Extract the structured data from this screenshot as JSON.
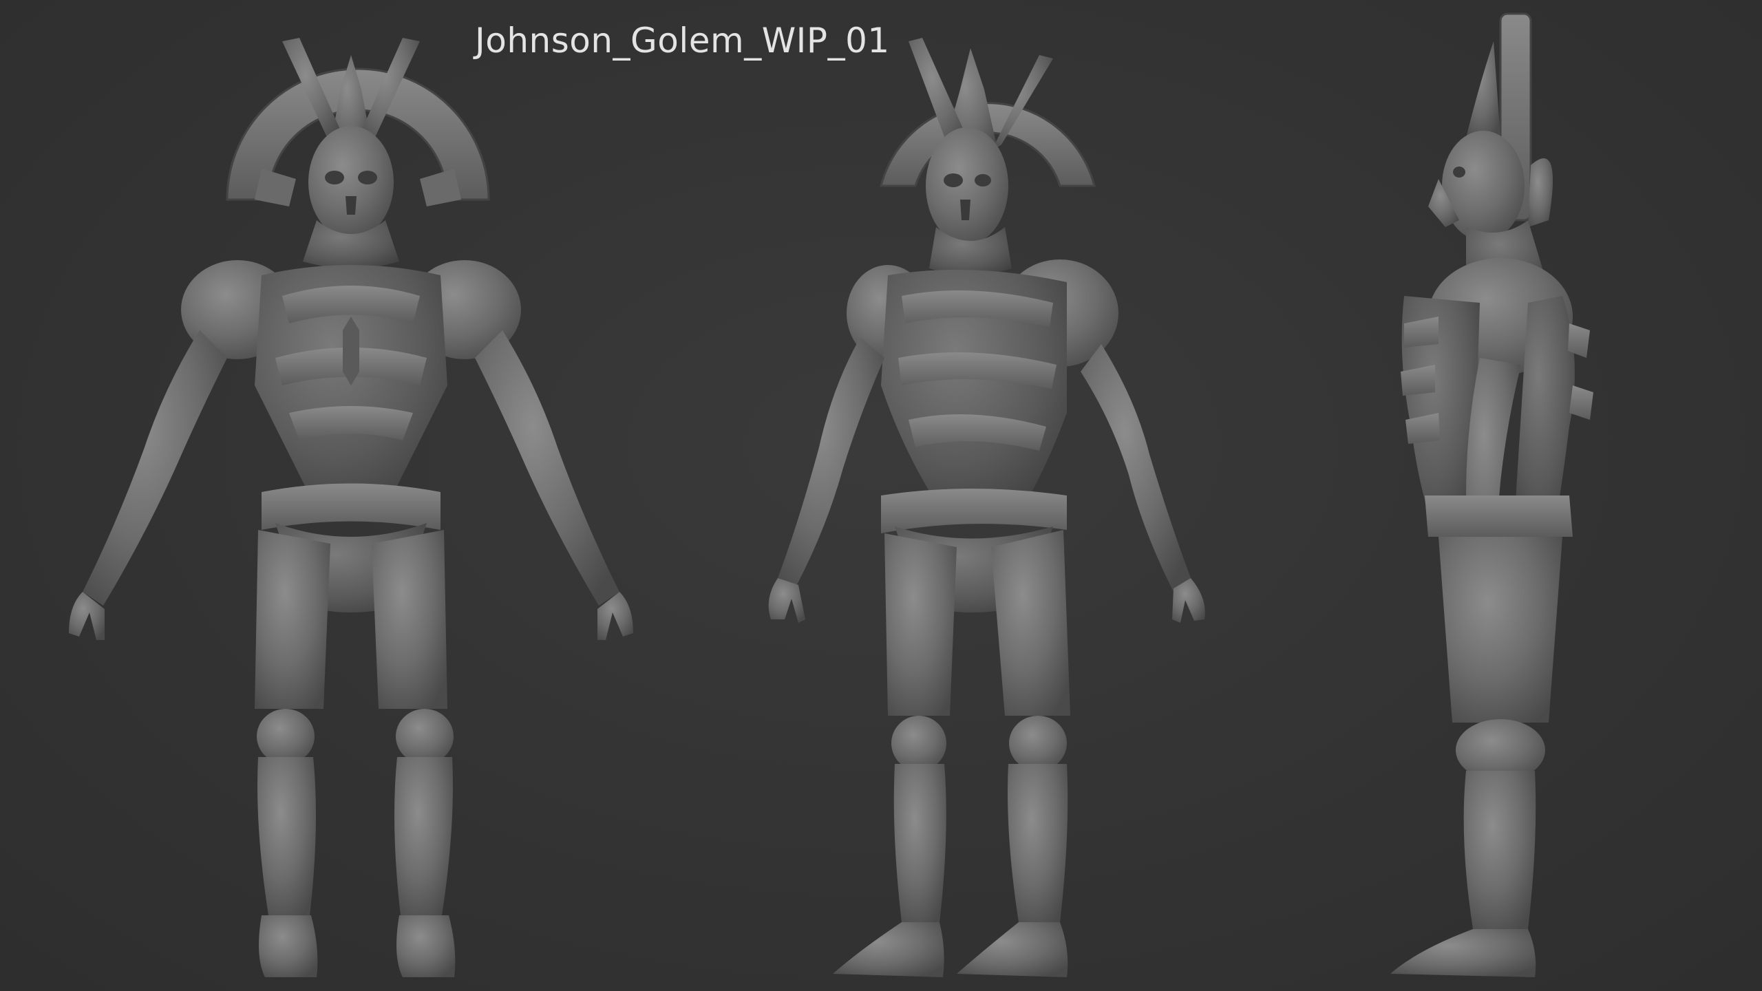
{
  "title": "Johnson_Golem_WIP_01",
  "views": [
    {
      "id": "front",
      "name": "front-view"
    },
    {
      "id": "three-quarter",
      "name": "three-quarter-view"
    },
    {
      "id": "side",
      "name": "side-view"
    }
  ],
  "colors": {
    "background": "#343434",
    "clay": "#6e6e6e",
    "clay_light": "#8a8a8a",
    "clay_dark": "#4f4f4f",
    "title_text": "#e4e4e4"
  }
}
